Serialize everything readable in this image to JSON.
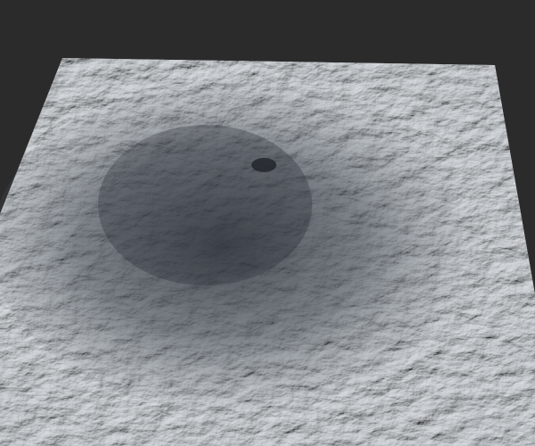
{
  "scene": {
    "subject": "terrain-mesh",
    "colors": {
      "background": "#2b2b2b",
      "terrain_light": "#c9ced3",
      "terrain_mid": "#9aa1a9",
      "terrain_shadow": "#3a4048"
    }
  }
}
